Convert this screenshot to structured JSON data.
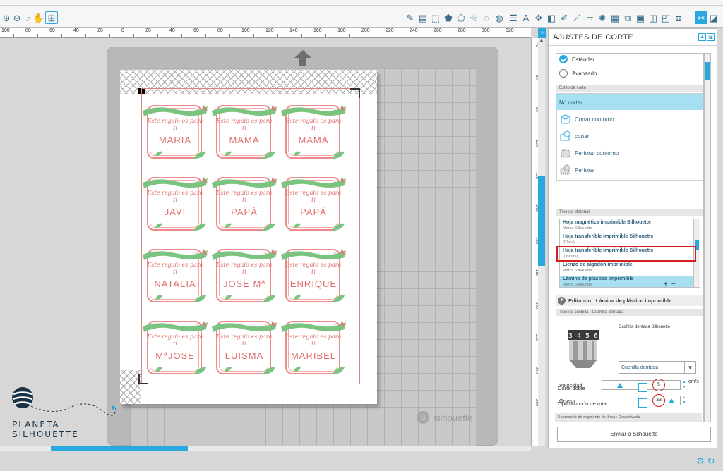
{
  "toolbar": {
    "left_tools": [
      "zoom-in-icon",
      "zoom-out-icon",
      "zoom-select-icon",
      "pan-icon",
      "fit-page-icon"
    ],
    "right_tools": [
      "edit-points-icon",
      "line-icon",
      "rectangle-icon",
      "polygon-icon",
      "pentagon-icon",
      "star-icon",
      "curve-icon",
      "ellipse-icon",
      "lines-icon",
      "text-icon",
      "move-icon",
      "split-icon",
      "pen-icon",
      "knife-icon",
      "eraser-icon",
      "lasso-icon",
      "library-icon",
      "send-icon",
      "register-icon",
      "mirror-icon",
      "cut-settings-icon",
      "fill-icon"
    ],
    "active_tool": "cut-settings-icon"
  },
  "ruler": {
    "h_ticks": [
      "100",
      "80",
      "60",
      "40",
      "20",
      "0",
      "20",
      "40",
      "60",
      "80",
      "100",
      "120",
      "140",
      "160",
      "180",
      "200",
      "220",
      "240",
      "260",
      "280",
      "300",
      "320"
    ],
    "v_ticks": [
      "40",
      "60",
      "80",
      "100",
      "120",
      "140",
      "160",
      "180",
      "200",
      "220",
      "240",
      "260"
    ]
  },
  "labels": {
    "prefix_text": "Este regalo es para ti",
    "names": [
      "MARIA",
      "MAMÁ",
      "MAMÁ",
      "JAVI",
      "PAPÁ",
      "PAPÁ",
      "NATALIA",
      "JOSE Mª",
      "ENRIQUE",
      "MªJOSE",
      "LUISMA",
      "MARIBEL"
    ]
  },
  "mat": {
    "brand": "silhouette"
  },
  "brand": {
    "text": "PLANETA SILHOUETTE"
  },
  "panel": {
    "title": "AJUSTES DE CORTE",
    "mode_options": [
      "Estándar",
      "Avanzado"
    ],
    "selected_mode": "Estándar",
    "cut_style_header": "Estilo de corte",
    "cut_styles": [
      "No cortar",
      "Cortar contorno",
      "cortar",
      "Perforar contorno",
      "Perforar"
    ],
    "selected_cut_style": "No cortar",
    "material_header": "Tipo de Material",
    "materials": [
      {
        "name": "Hoja magnética imprimible Silhouette",
        "sub": "Marca Silhouette"
      },
      {
        "name": "Hoja transferible imprimible Silhouette",
        "sub": "(Clara)"
      },
      {
        "name": "Hoja transferible imprimible Silhouette",
        "sub": "(Oscura)"
      },
      {
        "name": "Lienzo de algodón imprimible",
        "sub": "Marca Silhouette"
      },
      {
        "name": "Lámina de plástico imprimible",
        "sub": "Marca Silhouette"
      }
    ],
    "selected_material": "Lámina de plástico imprimible",
    "material_buttons": [
      "+",
      "−"
    ],
    "editing_text": "Editando : Lámina de plástico imprimible",
    "blade_header": "Tipo de cuchilla : Cuchilla dentada",
    "blade_name": "Cuchilla dentada Silhouette",
    "blade_digits": "3 4 5 6",
    "blade_select": "Cuchilla dentada",
    "speed_label": "Velocidad",
    "speed_value": "5",
    "speed_unit": "cm/s",
    "speed_level": 0.2,
    "thickness_label": "Grosor",
    "thickness_value": "33",
    "thickness_level": 0.9,
    "double_cut_label": "Corte doble",
    "route_opt_label": "Optimización de ruta",
    "overcut_text": "Sobrecorte de segmento de línea : Desactivada",
    "send_button": "Enviar a Silhouette"
  },
  "colors": {
    "accent": "#29a8e0",
    "label_red": "#e06e6e",
    "ribbon_green": "#7ac47f",
    "highlight": "#d02020"
  }
}
